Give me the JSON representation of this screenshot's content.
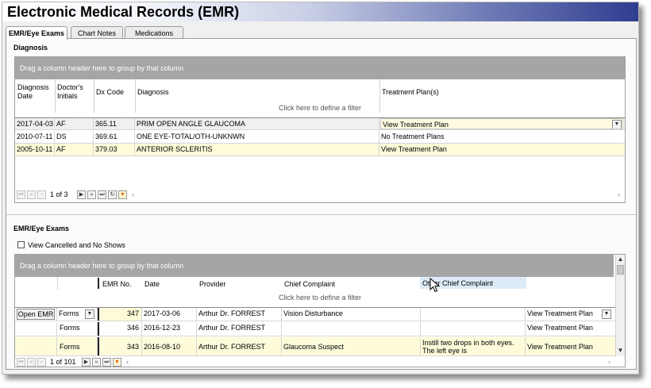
{
  "app": {
    "title": "Electronic Medical Records (EMR)"
  },
  "tabs": [
    {
      "label": "EMR/Eye Exams",
      "active": true
    },
    {
      "label": "Chart Notes",
      "active": false
    },
    {
      "label": "Medications",
      "active": false
    }
  ],
  "diagnosis": {
    "section_title": "Diagnosis",
    "group_panel": "Drag a column header here to group by that column",
    "columns": [
      "Diagnosis Date",
      "Doctor's Initials",
      "Dx Code",
      "Diagnosis",
      "Treatment Plan(s)"
    ],
    "filter_text": "Click here to define a filter",
    "rows": [
      {
        "date": "2017-04-03",
        "initials": "AF",
        "code": "365.11",
        "diagnosis": "PRIM OPEN ANGLE GLAUCOMA",
        "plan": "View Treatment Plan"
      },
      {
        "date": "2010-07-11",
        "initials": "DS",
        "code": "369.61",
        "diagnosis": "ONE EYE-TOTAL/OTH-UNKNWN",
        "plan": "No Treatment Plans"
      },
      {
        "date": "2005-10-11",
        "initials": "AF",
        "code": "379.03",
        "diagnosis": "ANTERIOR SCLERITIS",
        "plan": "View Treatment Plan"
      }
    ],
    "pager": {
      "text": "1 of 3"
    }
  },
  "exams": {
    "section_title": "EMR/Eye Exams",
    "checkbox_label": "View Cancelled and No Shows",
    "checkbox_checked": false,
    "group_panel": "Drag a column header here to group by that column",
    "columns": [
      "EMR No.",
      "Date",
      "Provider",
      "Chief Complaint",
      "Other Chief Complaint"
    ],
    "filter_text": "Click here to define a filter",
    "open_emr_label": "Open EMR",
    "rows": [
      {
        "forms": "Forms",
        "emr_no": "347",
        "date": "2017-03-06",
        "provider": "Arthur Dr. FORREST",
        "complaint": "Vision Disturbance",
        "other": "",
        "plan": "View Treatment Plan"
      },
      {
        "forms": "Forms",
        "emr_no": "346",
        "date": "2016-12-23",
        "provider": "Arthur Dr. FORREST",
        "complaint": "",
        "other": "",
        "plan": "View Treatment Plan"
      },
      {
        "forms": "Forms",
        "emr_no": "343",
        "date": "2016-08-10",
        "provider": "Arthur Dr. FORREST",
        "complaint": "Glaucoma Suspect",
        "other_line1": "Instill two drops in both eyes.",
        "other_line2": "The left eye  is",
        "plan": "View Treatment Plan"
      }
    ],
    "pager": {
      "text": "1 of 101"
    }
  },
  "icons": {
    "first": "first-page-icon",
    "prev_page": "prev-page-icon",
    "prev": "prev-icon",
    "next": "next-icon",
    "next_page": "next-page-icon",
    "last": "last-page-icon",
    "refresh": "refresh-icon",
    "filter": "filter-icon",
    "dropdown": "chevron-down-icon",
    "cursor": "mouse-pointer-icon"
  },
  "colors": {
    "group_panel": "#a5a5a5",
    "alt_row": "#fdfbd9",
    "title_gradient_end": "#2f3d90",
    "filter_icon": "#e07000"
  }
}
